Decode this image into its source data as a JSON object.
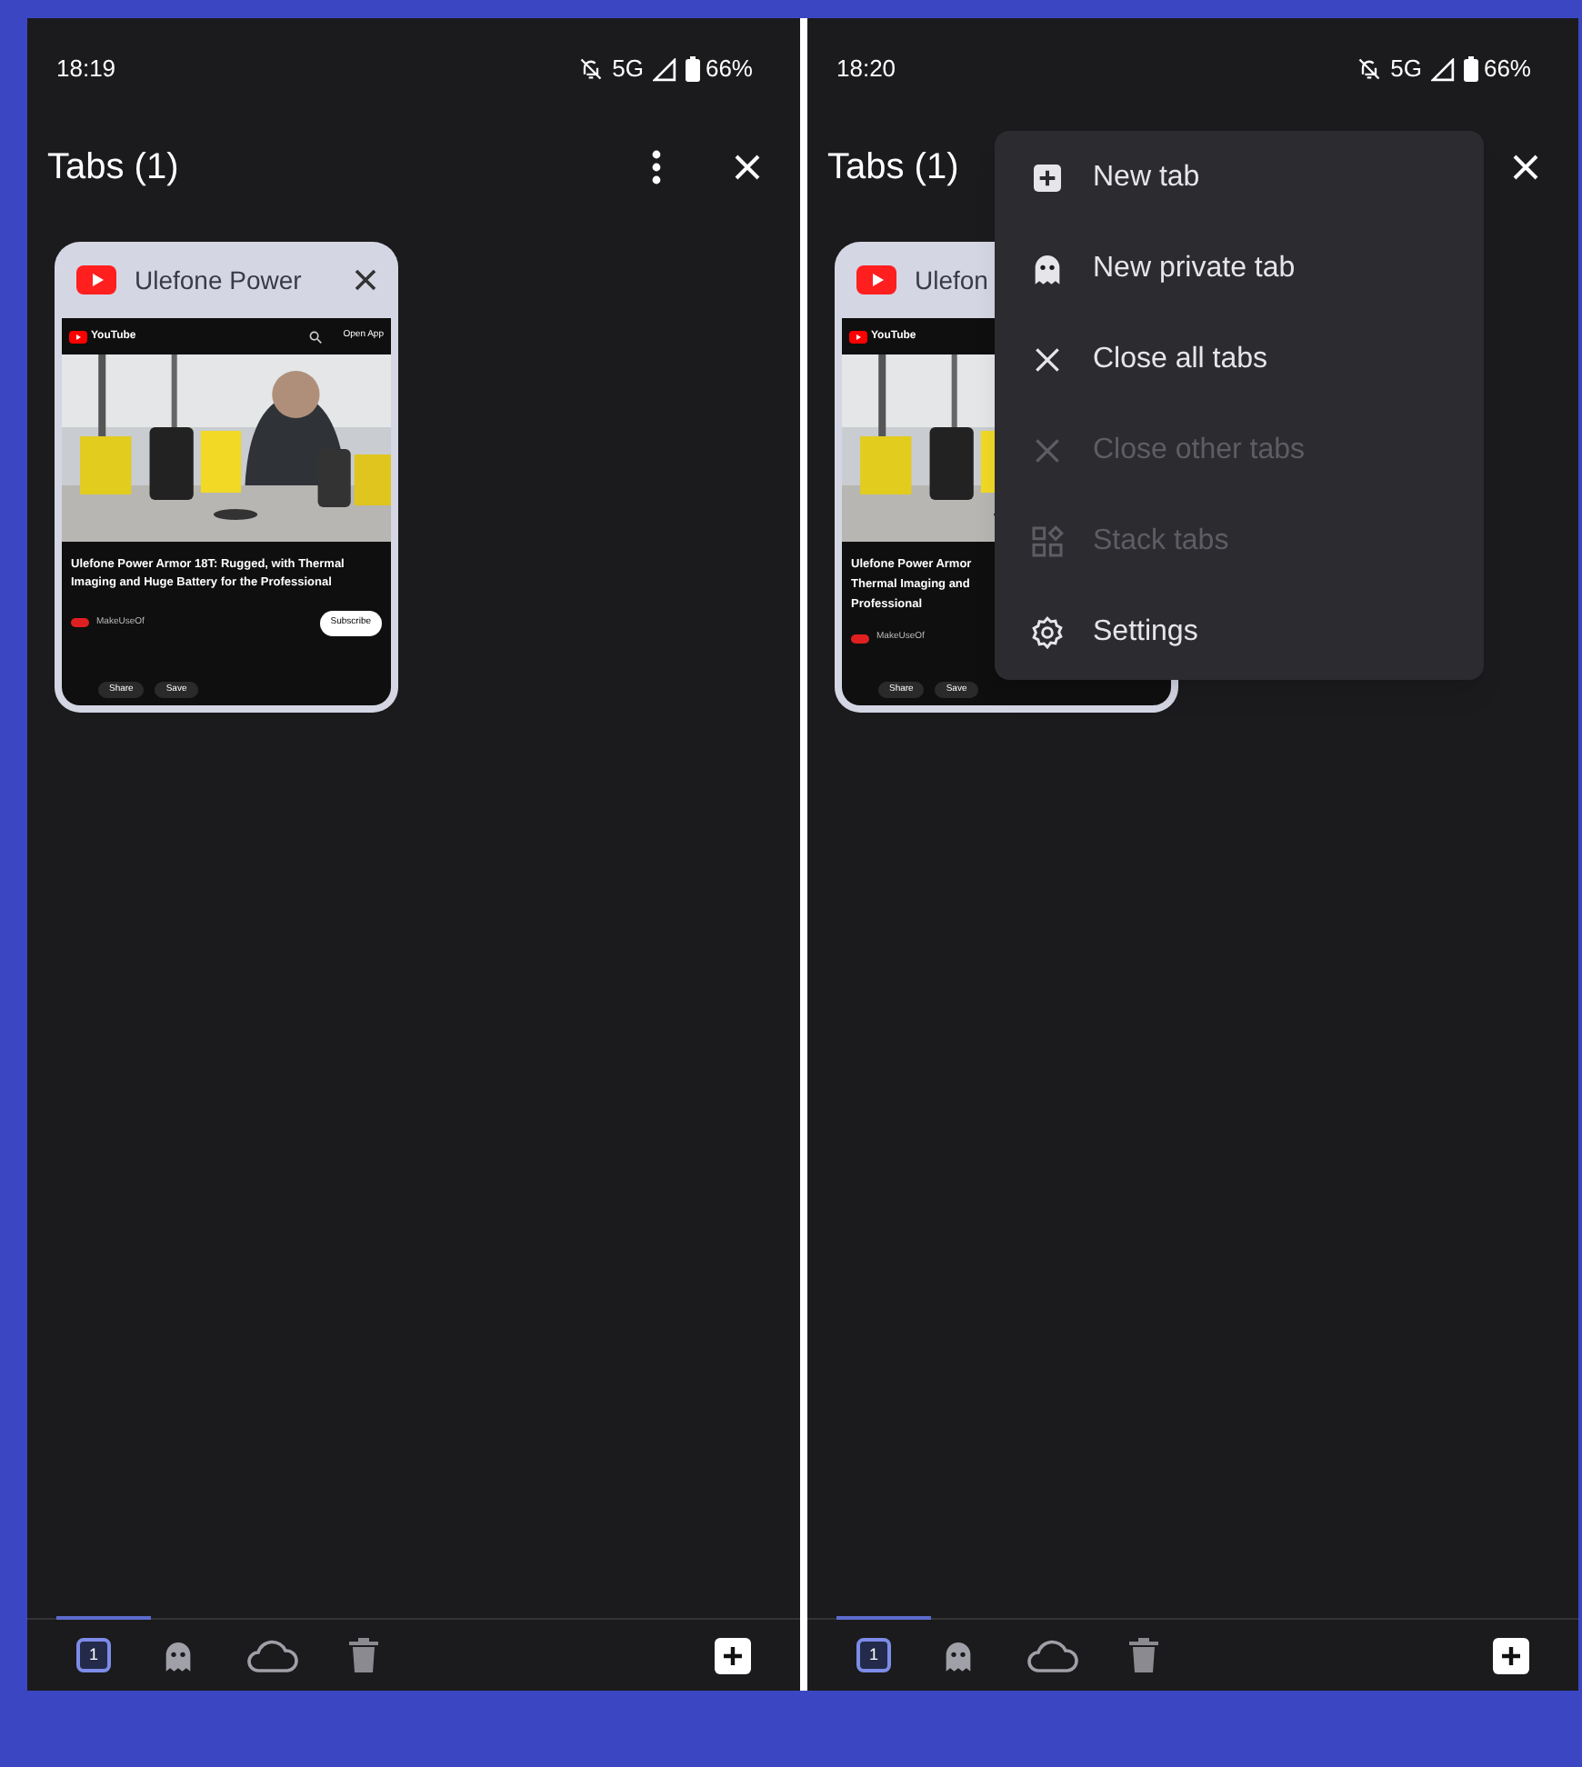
{
  "screens": [
    {
      "status_bar": {
        "time": "18:19",
        "network": "5G",
        "battery": "66%"
      },
      "header": {
        "title": "Tabs (1)"
      },
      "tab_card": {
        "title": "Ulefone Power",
        "thumbnail": {
          "site": "YouTube",
          "open_app": "Open App",
          "video_title": "Ulefone Power Armor 18T: Rugged, with Thermal Imaging and Huge Battery for the Professional",
          "channel": "MakeUseOf",
          "subscribe": "Subscribe",
          "chips": [
            "Share",
            "Save"
          ]
        }
      },
      "toolbar": {
        "groups": [
          {
            "kind": "tabs",
            "count": "1",
            "selected": true
          },
          {
            "kind": "private",
            "selected": false
          },
          {
            "kind": "synced",
            "selected": false
          }
        ]
      }
    },
    {
      "status_bar": {
        "time": "18:20",
        "network": "5G",
        "battery": "66%"
      },
      "header": {
        "title": "Tabs (1)"
      },
      "tab_card": {
        "title": "Ulefon",
        "thumbnail": {
          "site": "YouTube",
          "video_title_lines": [
            "Ulefone Power Armor",
            "Thermal Imaging and",
            "Professional"
          ],
          "channel": "MakeUseOf",
          "chips": [
            "Share",
            "Save"
          ]
        }
      },
      "menu": [
        {
          "kind": "new_tab",
          "label": "New tab",
          "disabled": false
        },
        {
          "kind": "private",
          "label": "New private tab",
          "disabled": false
        },
        {
          "kind": "close",
          "label": "Close all tabs",
          "disabled": false
        },
        {
          "kind": "close",
          "label": "Close other tabs",
          "disabled": true
        },
        {
          "kind": "stack",
          "label": "Stack tabs",
          "disabled": true
        },
        {
          "kind": "settings",
          "label": "Settings",
          "disabled": false
        }
      ],
      "toolbar": {
        "groups": [
          {
            "kind": "tabs",
            "count": "1",
            "selected": true
          },
          {
            "kind": "private",
            "selected": false
          },
          {
            "kind": "synced",
            "selected": false
          }
        ]
      }
    }
  ]
}
